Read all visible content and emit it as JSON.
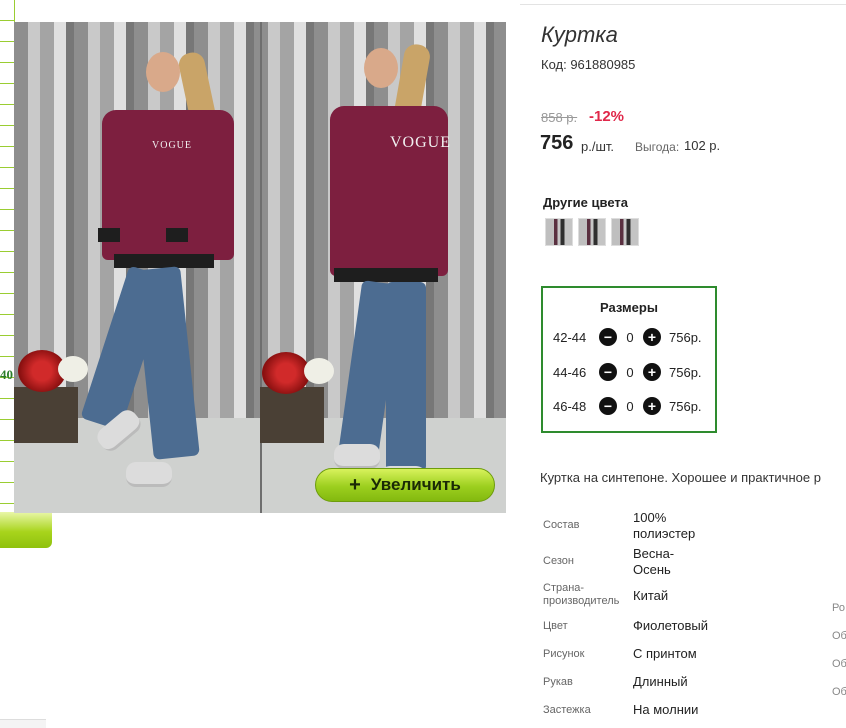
{
  "sidebar": {
    "badge": "40"
  },
  "photo": {
    "print_left": "VOGUE",
    "print_right": "VOGUE",
    "zoom_label": "Увеличить",
    "zoom_icon": "plus-icon"
  },
  "product": {
    "title": "Куртка",
    "code": "Код: 961880985",
    "old_price": "858 р.",
    "discount": "-12%",
    "price": "756",
    "price_unit": "р./шт.",
    "saving_label": "Выгода:",
    "saving_value": "102 р."
  },
  "colors": {
    "title": "Другие цвета",
    "count": 3
  },
  "sizes": {
    "title": "Размеры",
    "rows": [
      {
        "label": "42-44",
        "qty": "0",
        "price": "756р."
      },
      {
        "label": "44-46",
        "qty": "0",
        "price": "756р."
      },
      {
        "label": "46-48",
        "qty": "0",
        "price": "756р."
      }
    ],
    "minus_icon": "minus-circle-icon",
    "plus_icon": "plus-circle-icon"
  },
  "description": "Куртка на синтепоне. Хорошее и практичное р",
  "specs": [
    {
      "label": "Состав",
      "value": "100% полиэстер"
    },
    {
      "label": "Сезон",
      "value": "Весна-Осень"
    },
    {
      "label": "Страна-производитель",
      "value": "Китай"
    },
    {
      "label": "Цвет",
      "value": "Фиолетовый"
    },
    {
      "label": "Рисунок",
      "value": "С принтом"
    },
    {
      "label": "Рукав",
      "value": "Длинный"
    },
    {
      "label": "Застежка",
      "value": "На молнии"
    }
  ],
  "right_edge_cut": [
    "Ро",
    "Об",
    "Об",
    "Об"
  ],
  "colors_palette": {
    "accent_green": "#2e8b2e",
    "discount_red": "#e0284a",
    "button_green": "#9ccf1e"
  }
}
